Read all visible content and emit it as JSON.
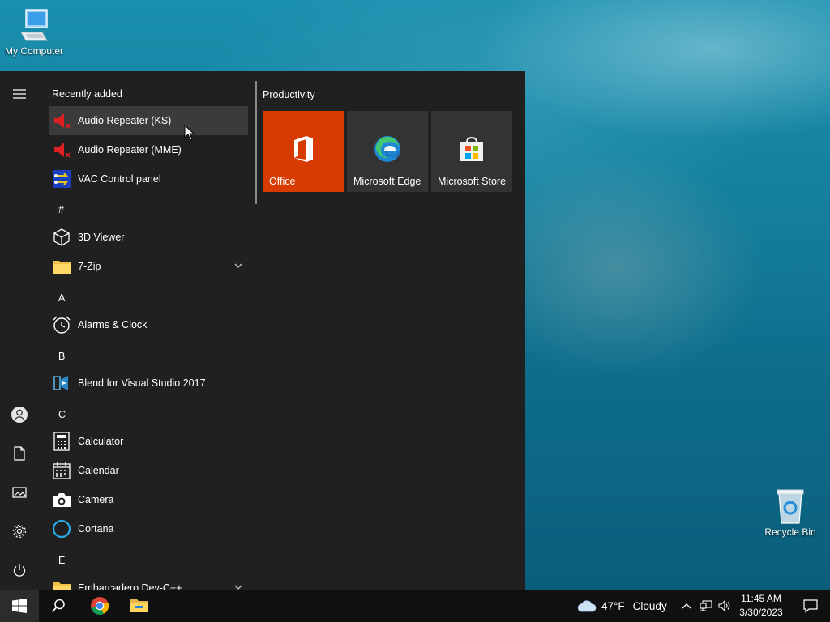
{
  "desktop": {
    "icons": [
      {
        "label": "My Computer",
        "icon": "computer-icon"
      },
      {
        "label": "Recycle Bin",
        "icon": "recycle-bin-icon"
      }
    ]
  },
  "start_menu": {
    "rail": {
      "items": [
        {
          "name": "menu-icon"
        },
        {
          "name": "user-icon"
        },
        {
          "name": "documents-icon"
        },
        {
          "name": "pictures-icon"
        },
        {
          "name": "settings-icon"
        },
        {
          "name": "power-icon"
        }
      ]
    },
    "app_list": {
      "recently_added_label": "Recently added",
      "recent": [
        {
          "label": "Audio Repeater (KS)",
          "icon": "audio-repeater-icon"
        },
        {
          "label": "Audio Repeater (MME)",
          "icon": "audio-repeater-icon"
        },
        {
          "label": "VAC Control panel",
          "icon": "vac-control-icon"
        }
      ],
      "groups": [
        {
          "letter": "#",
          "apps": [
            {
              "label": "3D Viewer",
              "icon": "cube-icon"
            },
            {
              "label": "7-Zip",
              "icon": "folder-icon",
              "expandable": true
            }
          ]
        },
        {
          "letter": "A",
          "apps": [
            {
              "label": "Alarms & Clock",
              "icon": "alarm-clock-icon"
            }
          ]
        },
        {
          "letter": "B",
          "apps": [
            {
              "label": "Blend for Visual Studio 2017",
              "icon": "blend-icon"
            }
          ]
        },
        {
          "letter": "C",
          "apps": [
            {
              "label": "Calculator",
              "icon": "calculator-icon"
            },
            {
              "label": "Calendar",
              "icon": "calendar-icon"
            },
            {
              "label": "Camera",
              "icon": "camera-icon"
            },
            {
              "label": "Cortana",
              "icon": "cortana-icon"
            }
          ]
        },
        {
          "letter": "E",
          "apps": [
            {
              "label": "Embarcadero Dev-C++",
              "icon": "folder-icon",
              "expandable": true
            }
          ]
        }
      ]
    },
    "tiles": {
      "group_title": "Productivity",
      "items": [
        {
          "label": "Office",
          "icon": "office-icon",
          "color": "#d83b01"
        },
        {
          "label": "Microsoft Edge",
          "icon": "edge-icon",
          "color": "#333333"
        },
        {
          "label": "Microsoft Store",
          "icon": "store-icon",
          "color": "#333333"
        }
      ]
    }
  },
  "taskbar": {
    "pinned": [
      {
        "name": "windows-start-icon"
      },
      {
        "name": "search-icon"
      },
      {
        "name": "chrome-icon"
      },
      {
        "name": "file-explorer-icon"
      }
    ],
    "weather": {
      "temp": "47°F",
      "condition": "Cloudy",
      "icon": "cloud-icon"
    },
    "tray_icons": [
      "chevron-up-icon",
      "network-icon",
      "volume-icon"
    ],
    "time": "11:45 AM",
    "date": "3/30/2023",
    "notification_icon": "notification-icon"
  },
  "colors": {
    "menu_bg": "#202020",
    "hover_bg": "#3b3b3b",
    "taskbar_bg": "#101010",
    "office_tile": "#d83b01"
  }
}
